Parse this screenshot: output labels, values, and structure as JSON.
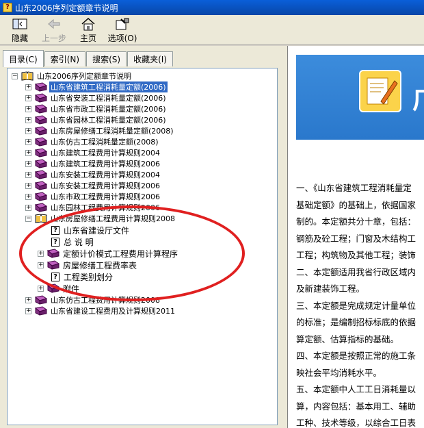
{
  "window": {
    "title": "山东2006序列定额章节说明",
    "app_icon_char": "?"
  },
  "toolbar": [
    {
      "label": "隐藏",
      "icon": "hide-icon",
      "enabled": true
    },
    {
      "label": "上一步",
      "icon": "back-arrow-icon",
      "enabled": false
    },
    {
      "label": "主页",
      "icon": "home-icon",
      "enabled": true
    },
    {
      "label": "选项(O)",
      "icon": "options-icon",
      "enabled": true
    }
  ],
  "tabs": [
    {
      "label": "目录(C)",
      "active": true
    },
    {
      "label": "索引(N)",
      "active": false
    },
    {
      "label": "搜索(S)",
      "active": false
    },
    {
      "label": "收藏夹(I)",
      "active": false
    }
  ],
  "tree": {
    "root": "山东2006序列定额章节说明",
    "items": [
      {
        "label": "山东省建筑工程消耗量定额(2006)",
        "selected": true
      },
      {
        "label": "山东省安装工程消耗量定额(2006)"
      },
      {
        "label": "山东省市政工程消耗量定额(2006)"
      },
      {
        "label": "山东省园林工程消耗量定额(2006)"
      },
      {
        "label": "山东房屋修缮工程消耗量定额(2008)"
      },
      {
        "label": "山东仿古工程消耗量定额(2008)"
      },
      {
        "label": "山东建筑工程费用计算规则2004"
      },
      {
        "label": "山东建筑工程费用计算规则2006"
      },
      {
        "label": "山东安装工程费用计算规则2004"
      },
      {
        "label": "山东安装工程费用计算规则2006"
      },
      {
        "label": "山东市政工程费用计算规则2006"
      },
      {
        "label": "山东园林工程费用计算规则2006"
      },
      {
        "label": "山东房屋修缮工程费用计算规则2008",
        "expanded": true
      },
      {
        "label": "山东仿古工程费用计算规则2008"
      },
      {
        "label": "山东省建设工程费用及计算规则2011"
      }
    ],
    "children": [
      {
        "label": "山东省建设厅文件",
        "type": "page"
      },
      {
        "label": "总 说 明",
        "type": "page"
      },
      {
        "label": "定额计价模式工程费用计算程序",
        "type": "book"
      },
      {
        "label": "房屋修缮工程费率表",
        "type": "book"
      },
      {
        "label": "工程类别划分",
        "type": "page"
      },
      {
        "label": "附件",
        "type": "book"
      }
    ]
  },
  "content": {
    "banner_mark": "广",
    "paragraphs": [
      "一、《山东省建筑工程消耗量定",
      "基础定额》的基础上，依据国家",
      "制的。本定额共分十章，包括：",
      "钢筋及砼工程；门窗及木结构工",
      "工程；构筑物及其他工程；装饰",
      "二、本定额适用我省行政区域内",
      "及新建装饰工程。",
      "三、本定额是完成规定计量单位",
      "的标准；是编制招标标底的依据",
      "算定额、估算指标的基础。",
      "四、本定额是按照正常的施工条",
      "映社会平均消耗水平。",
      "五、本定额中人工工日消耗量以",
      "算，内容包括：基本用工、辅助",
      "工种、技术等级，以综合工日表"
    ]
  },
  "colors": {
    "selection": "#316ac5",
    "annotation": "#e02020",
    "banner": "#2a78cc"
  }
}
